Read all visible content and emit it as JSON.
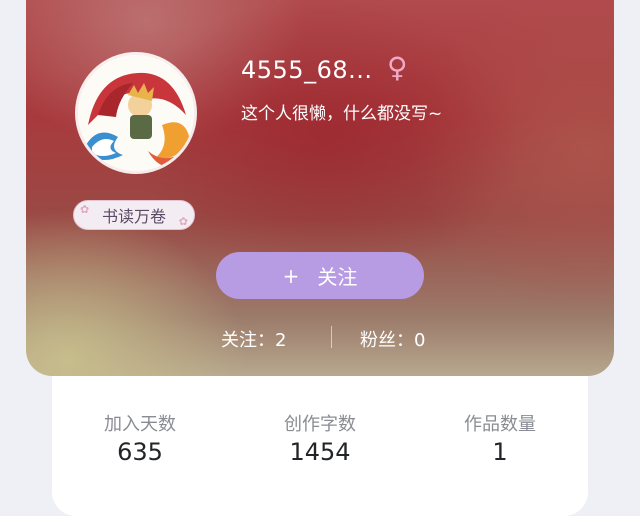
{
  "profile": {
    "username": "4555_68...",
    "gender_icon": "female-icon",
    "bio": "这个人很懒，什么都没写~",
    "badge": "书读万卷",
    "follow_button": {
      "plus": "+",
      "label": "关注"
    },
    "following": {
      "label": "关注：",
      "value": "2"
    },
    "fans": {
      "label": "粉丝：",
      "value": "0"
    }
  },
  "stats": [
    {
      "label": "加入天数",
      "value": "635"
    },
    {
      "label": "创作字数",
      "value": "1454"
    },
    {
      "label": "作品数量",
      "value": "1"
    }
  ],
  "colors": {
    "follow_button": "#b79be3",
    "gender_icon": "#f1a9c8",
    "hero_primary": "#a83a3d"
  }
}
